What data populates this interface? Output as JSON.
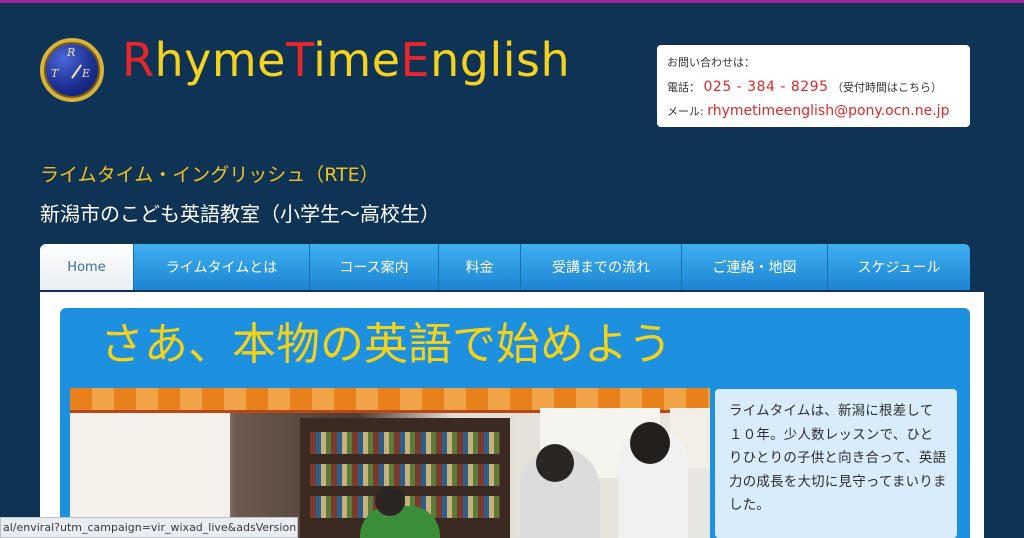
{
  "brand": {
    "logo_letters": [
      "R",
      "T",
      "E"
    ],
    "name_parts": [
      {
        "text": "R",
        "accent": true
      },
      {
        "text": "hyme",
        "accent": false
      },
      {
        "text": "T",
        "accent": true
      },
      {
        "text": "ime",
        "accent": false
      },
      {
        "text": "E",
        "accent": true
      },
      {
        "text": "nglish",
        "accent": false
      }
    ],
    "colors": {
      "main": "#f5d21b",
      "accent": "#e8262b",
      "background": "#0f3354"
    }
  },
  "contact": {
    "heading": "お問い合わせは：",
    "phone_label": "電話：",
    "phone": "025 - 384 - 8295",
    "phone_note": "（受付時間はこちら）",
    "mail_label": "メール:",
    "email": "rhymetimeenglish@pony.ocn.ne.jp"
  },
  "header": {
    "subtitle": "ライムタイム・イングリッシュ（RTE）",
    "tagline": "新潟市のこども英語教室（小学生～高校生）"
  },
  "nav": {
    "items": [
      {
        "label": "Home",
        "active": true
      },
      {
        "label": "ライムタイムとは",
        "active": false
      },
      {
        "label": "コース案内",
        "active": false
      },
      {
        "label": "料金",
        "active": false
      },
      {
        "label": "受講までの流れ",
        "active": false
      },
      {
        "label": "ご連絡・地図",
        "active": false
      },
      {
        "label": "スケジュール",
        "active": false
      }
    ]
  },
  "main": {
    "hero_title": "さあ、本物の英語で始めよう",
    "intro_text": "ライムタイムは、新潟に根差して１０年。少人数レッスンで、ひとりひとりの子供と向き合って、英語力の成長を大切に見守ってまいりました。"
  },
  "status_bar": {
    "url": "al/enviral?utm_campaign=vir_wixad_live&adsVersion=w..."
  }
}
